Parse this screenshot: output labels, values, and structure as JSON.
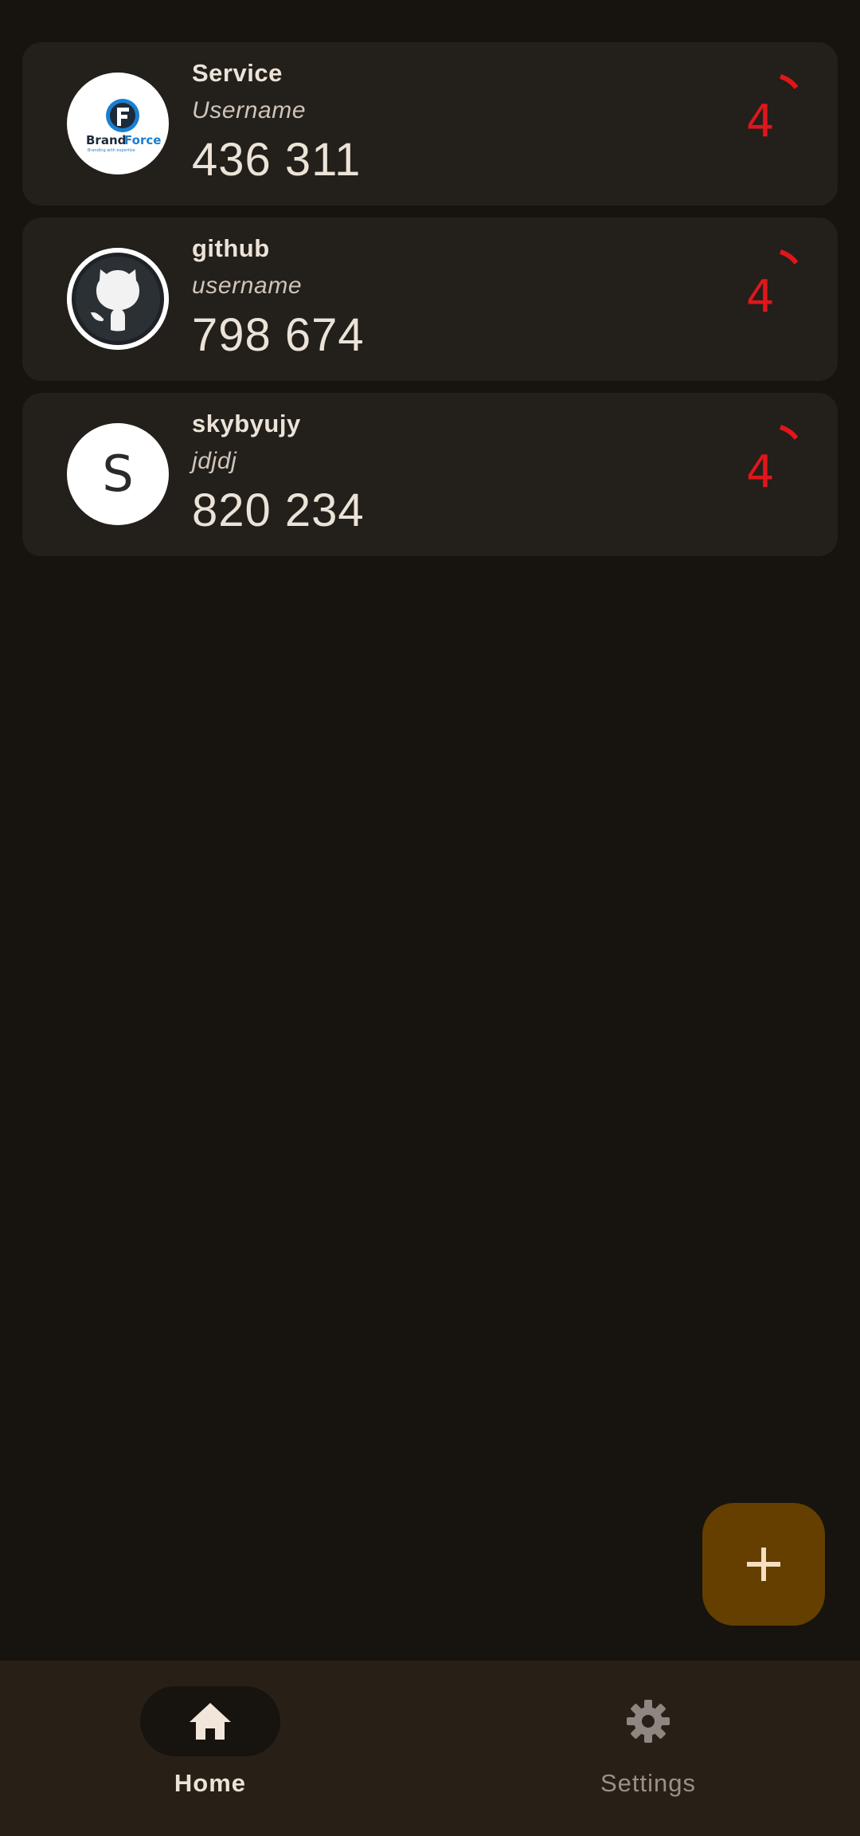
{
  "accounts": [
    {
      "service": "Service",
      "username": "Username",
      "code": "436 311",
      "timer": "4",
      "avatar_icon": "brandforce-logo-icon",
      "logo_text_brand": "Brand",
      "logo_text_force": "Force",
      "logo_tagline": "Branding with expertise"
    },
    {
      "service": "github",
      "username": "username",
      "code": "798 674",
      "timer": "4",
      "avatar_icon": "github-icon"
    },
    {
      "service": "skybyujy",
      "username": "jdjdj",
      "code": "820 234",
      "timer": "4",
      "avatar_letter": "S"
    }
  ],
  "fab": {
    "icon": "plus-icon"
  },
  "nav": {
    "home_label": "Home",
    "settings_label": "Settings",
    "home_icon": "home-icon",
    "settings_icon": "gear-icon"
  },
  "colors": {
    "background": "#17130e",
    "card": "#231f1b",
    "timer": "#e0161a",
    "fab": "#643f00",
    "navbar": "#282017"
  }
}
